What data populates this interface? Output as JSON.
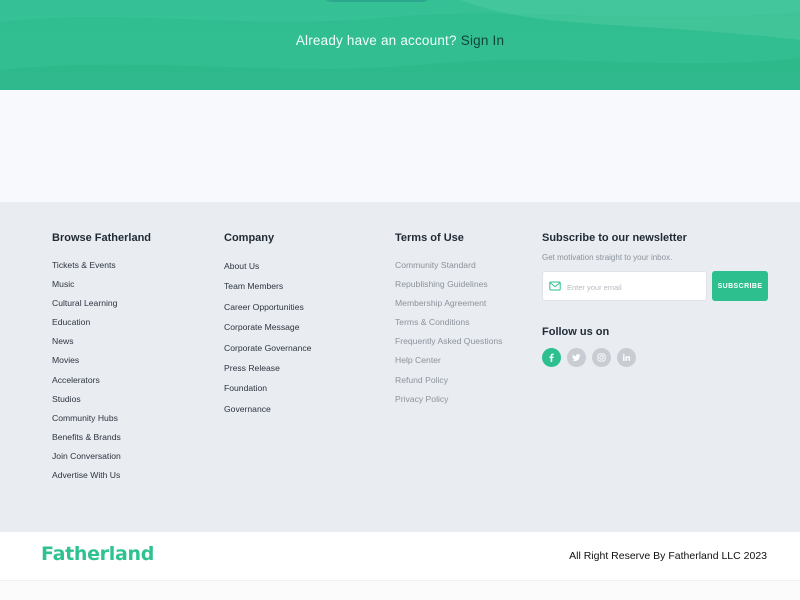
{
  "hero": {
    "prompt_text": "Already have an account?",
    "signin_link": "Sign In"
  },
  "columns": {
    "browse": {
      "title": "Browse Fatherland",
      "items": [
        "Tickets & Events",
        "Music",
        "Cultural Learning",
        "Education",
        "News",
        "Movies",
        "Accelerators",
        "Studios",
        "Community Hubs",
        "Benefits & Brands",
        "Join Conversation",
        "Advertise With Us"
      ]
    },
    "company": {
      "title": "Company",
      "items": [
        "About Us",
        "Team Members",
        "Career Opportunities",
        "Corporate Message",
        "Corporate Governance",
        "Press Release",
        "Foundation",
        "Governance"
      ]
    },
    "terms": {
      "title": "Terms of Use",
      "items": [
        "Community Standard",
        "Republishing Guidelines",
        "Membership Agreement",
        "Terms & Conditions",
        "Frequently Asked Questions",
        "Help Center",
        "Refund Policy",
        "Privacy Policy"
      ]
    }
  },
  "newsletter": {
    "title": "Subscribe to our newsletter",
    "description": "Get motivation straight to your inbox.",
    "email_placeholder": "Enter your email",
    "subscribe_label": "SUBSCRIBE",
    "follow_title": "Follow us on",
    "socials": [
      "facebook-icon",
      "twitter-icon",
      "instagram-icon",
      "linkedin-icon"
    ]
  },
  "bottom": {
    "logo": "Fatherland",
    "copyright": "All Right Reserve By Fatherland LLC 2023"
  },
  "colors": {
    "accent": "#2ebf8f",
    "footer_bg": "#e9ecf1",
    "signin": "#12463a"
  }
}
